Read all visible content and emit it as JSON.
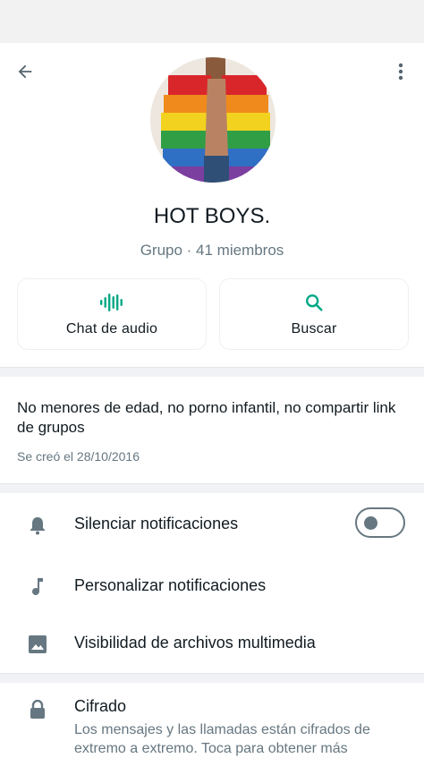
{
  "header": {
    "back_icon": "arrow-left-icon",
    "menu_icon": "more-vert-icon"
  },
  "group": {
    "name": "HOT BOYS.",
    "subtitle": "Grupo · 41 miembros"
  },
  "actions": [
    {
      "label": "Chat de audio",
      "icon": "audio-wave-icon",
      "color": "#00a884"
    },
    {
      "label": "Buscar",
      "icon": "search-icon",
      "color": "#00a884"
    }
  ],
  "about": {
    "description": "No menores de edad, no porno infantil, no compartir link de grupos",
    "created": "Se creó el 28/10/2016"
  },
  "settings": {
    "mute": {
      "label": "Silenciar notificaciones",
      "icon": "bell-icon",
      "enabled": false
    },
    "custom": {
      "label": "Personalizar notificaciones",
      "icon": "music-note-icon"
    },
    "media": {
      "label": "Visibilidad de archivos multimedia",
      "icon": "image-icon"
    }
  },
  "encryption": {
    "title": "Cifrado",
    "description": "Los mensajes y las llamadas están cifrados de extremo a extremo. Toca para obtener más",
    "icon": "lock-icon"
  },
  "colors": {
    "accent": "#00a884",
    "icon_gray": "#667781",
    "text_primary": "#111b21"
  }
}
